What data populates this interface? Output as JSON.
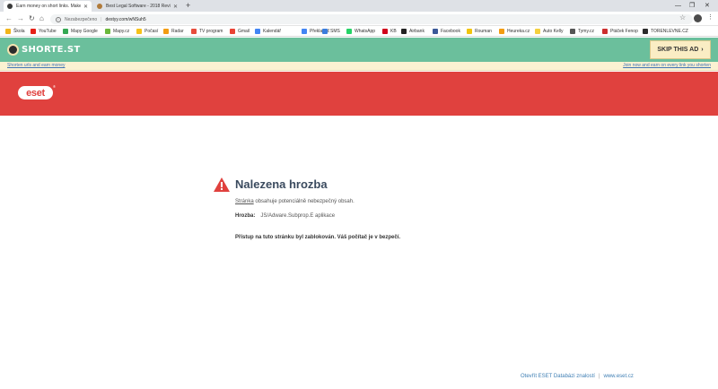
{
  "browser": {
    "tabs": [
      {
        "title": "Earn money on short links. Make"
      },
      {
        "title": "Best Legal Software - 2018 Revi"
      }
    ],
    "address": {
      "security": "Nezabezpečeno",
      "url": "destyy.com/wNSuh5"
    },
    "bookmarks": [
      {
        "label": "Škola",
        "color": "#f2b51a"
      },
      {
        "label": "YouTube",
        "color": "#e62117"
      },
      {
        "label": "Mapy Google",
        "color": "#34a853"
      },
      {
        "label": "Mapy.cz",
        "color": "#6bb83b"
      },
      {
        "label": "Počasí",
        "color": "#f6c11a"
      },
      {
        "label": "Radar",
        "color": "#f39c12"
      },
      {
        "label": "TV program",
        "color": "#e74c3c"
      },
      {
        "label": "Gmail",
        "color": "#ea4335"
      },
      {
        "label": "Kalendář",
        "color": "#4285f4"
      },
      {
        "label": "Překladač",
        "color": "#4285f4"
      },
      {
        "label": "SMS",
        "color": "#3b7ddd"
      },
      {
        "label": "WhatsApp",
        "color": "#25d366"
      },
      {
        "label": "KB",
        "color": "#d0021b"
      },
      {
        "label": "Airbank",
        "color": "#222222"
      },
      {
        "label": "Facebook",
        "color": "#3b5998"
      },
      {
        "label": "Rouman",
        "color": "#f1c40f"
      },
      {
        "label": "Heureka.cz",
        "color": "#f39c12"
      },
      {
        "label": "Auto Kelly",
        "color": "#f4d03f"
      },
      {
        "label": "Tymy.cz",
        "color": "#555555"
      },
      {
        "label": "Ptáček Fenop",
        "color": "#cc2e2e"
      },
      {
        "label": "TORENLEVNE.CZ",
        "color": "#2b2b2b"
      }
    ]
  },
  "shorte": {
    "logo_text": "SHORTE.ST",
    "skip_label": "SKIP THIS AD",
    "skip_arrow": "›",
    "left_link": "Shorten urls and earn money",
    "right_link": "Join now and earn on every link you shorten"
  },
  "eset": {
    "logo": "eset",
    "reg": "®",
    "title": "Nalezena hrozba",
    "line1_link": "Stránka",
    "line1_rest": " obsahuje potenciálně nebezpečný obsah.",
    "threat_label": "Hrozba:",
    "threat_value": "JS/Adware.Subprop.E aplikace",
    "blocked": "Přístup na tuto stránku byl zablokován. Váš počítač je v bezpečí.",
    "footer_link1": "Otevřít ESET Databázi znalostí",
    "footer_sep": "|",
    "footer_link2": "www.eset.cz",
    "warn_color": "#e0413e"
  }
}
